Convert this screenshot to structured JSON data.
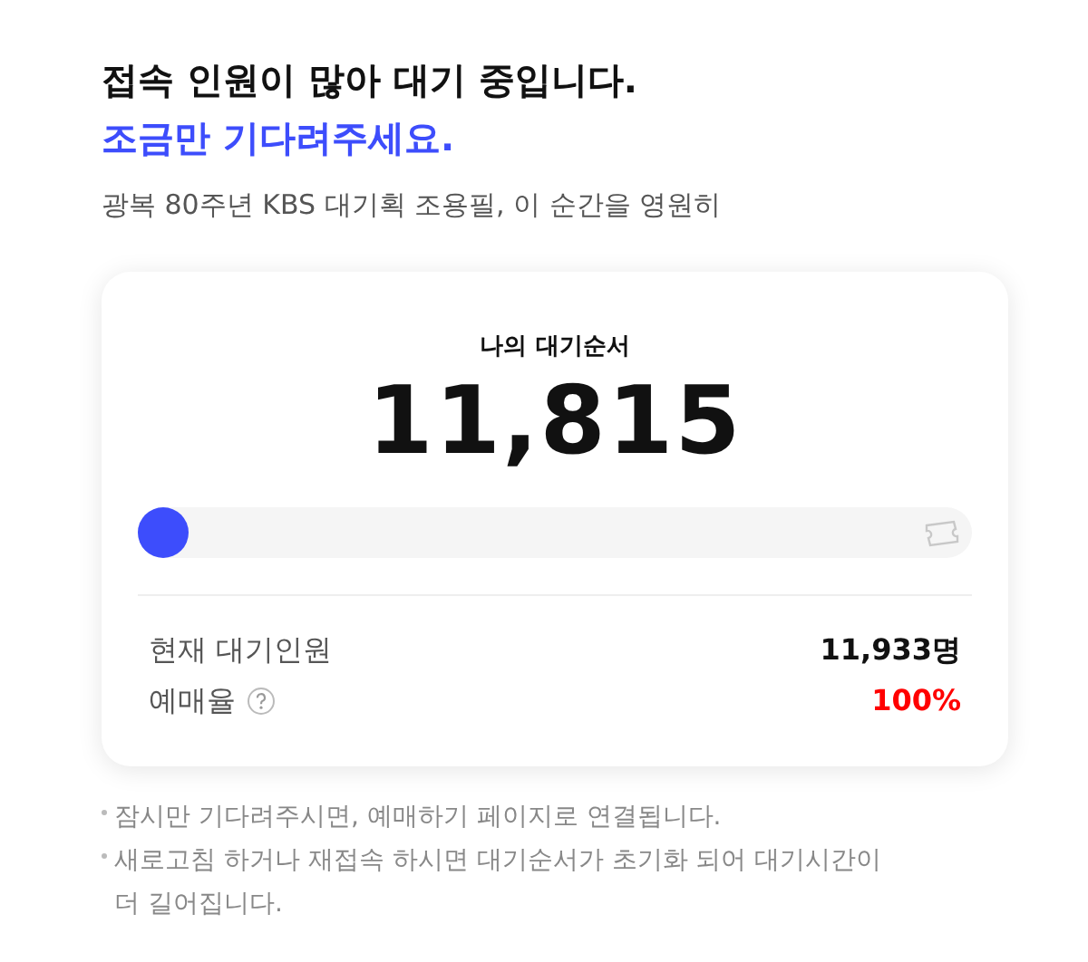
{
  "heading": {
    "line_1": "접속 인원이 많아 대기 중입니다.",
    "line_2": "조금만 기다려주세요."
  },
  "subtitle": "광복 80주년 KBS 대기획 조용필, 이 순간을 영원히",
  "queue": {
    "label": "나의 대기순서",
    "number": "11,815",
    "progress": {
      "level": 0
    }
  },
  "stats": [
    {
      "label": "현재 대기인원",
      "value": "11,933명",
      "kind": "count",
      "help": false
    },
    {
      "label": "예매율",
      "value": "100%",
      "kind": "rate",
      "help": true
    }
  ],
  "notes": [
    "잠시만 기다려주시면, 예매하기 페이지로 연결됩니다.",
    "새로고침 하거나 재접속 하시면 대기순서가 초기화 되어 대기시간이 더 길어집니다."
  ]
}
